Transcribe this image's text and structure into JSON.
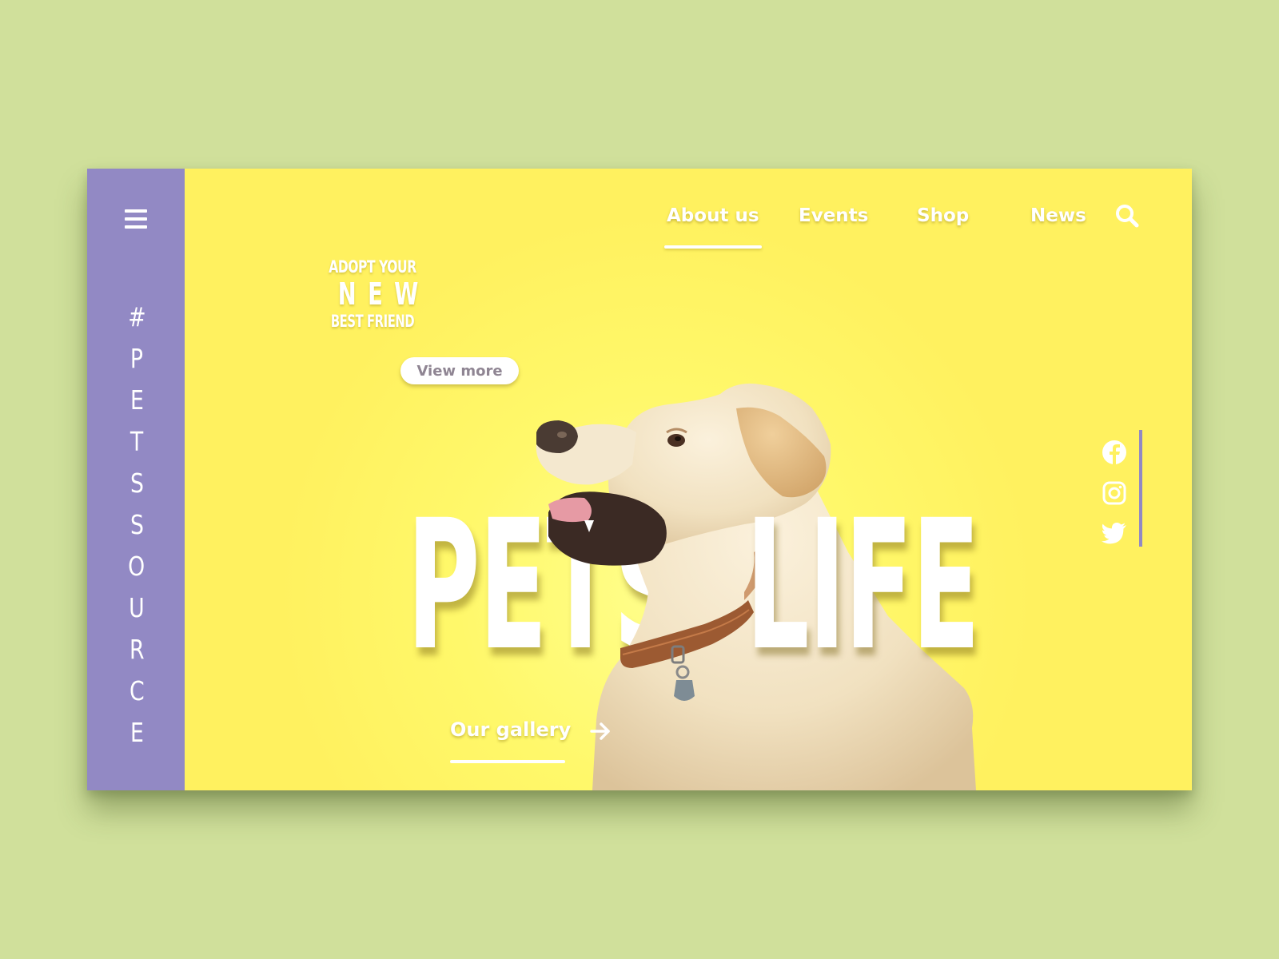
{
  "sidebar": {
    "menu_icon": "hamburger-menu-icon",
    "brand_vertical": "#PETSSOURCE"
  },
  "nav": {
    "items": [
      {
        "label": "About us",
        "active": true
      },
      {
        "label": "Events",
        "active": false
      },
      {
        "label": "Shop",
        "active": false
      },
      {
        "label": "News",
        "active": false
      }
    ],
    "search_icon": "search-icon"
  },
  "hero": {
    "tagline_line1": "ADOPT YOUR",
    "tagline_line2": "NEW",
    "tagline_line3": "BEST FRIEND",
    "view_more_label": "View more",
    "headline_left": "PETS",
    "headline_right": "LIFE",
    "gallery_label": "Our gallery",
    "gallery_icon": "arrow-right-icon"
  },
  "social": {
    "icons": [
      "facebook-icon",
      "instagram-icon",
      "twitter-icon"
    ]
  },
  "colors": {
    "page_background": "#d0e09b",
    "sidebar": "#9289c4",
    "hero_background": "#fff15f",
    "text": "#ffffff",
    "button_text": "#8f8593"
  }
}
